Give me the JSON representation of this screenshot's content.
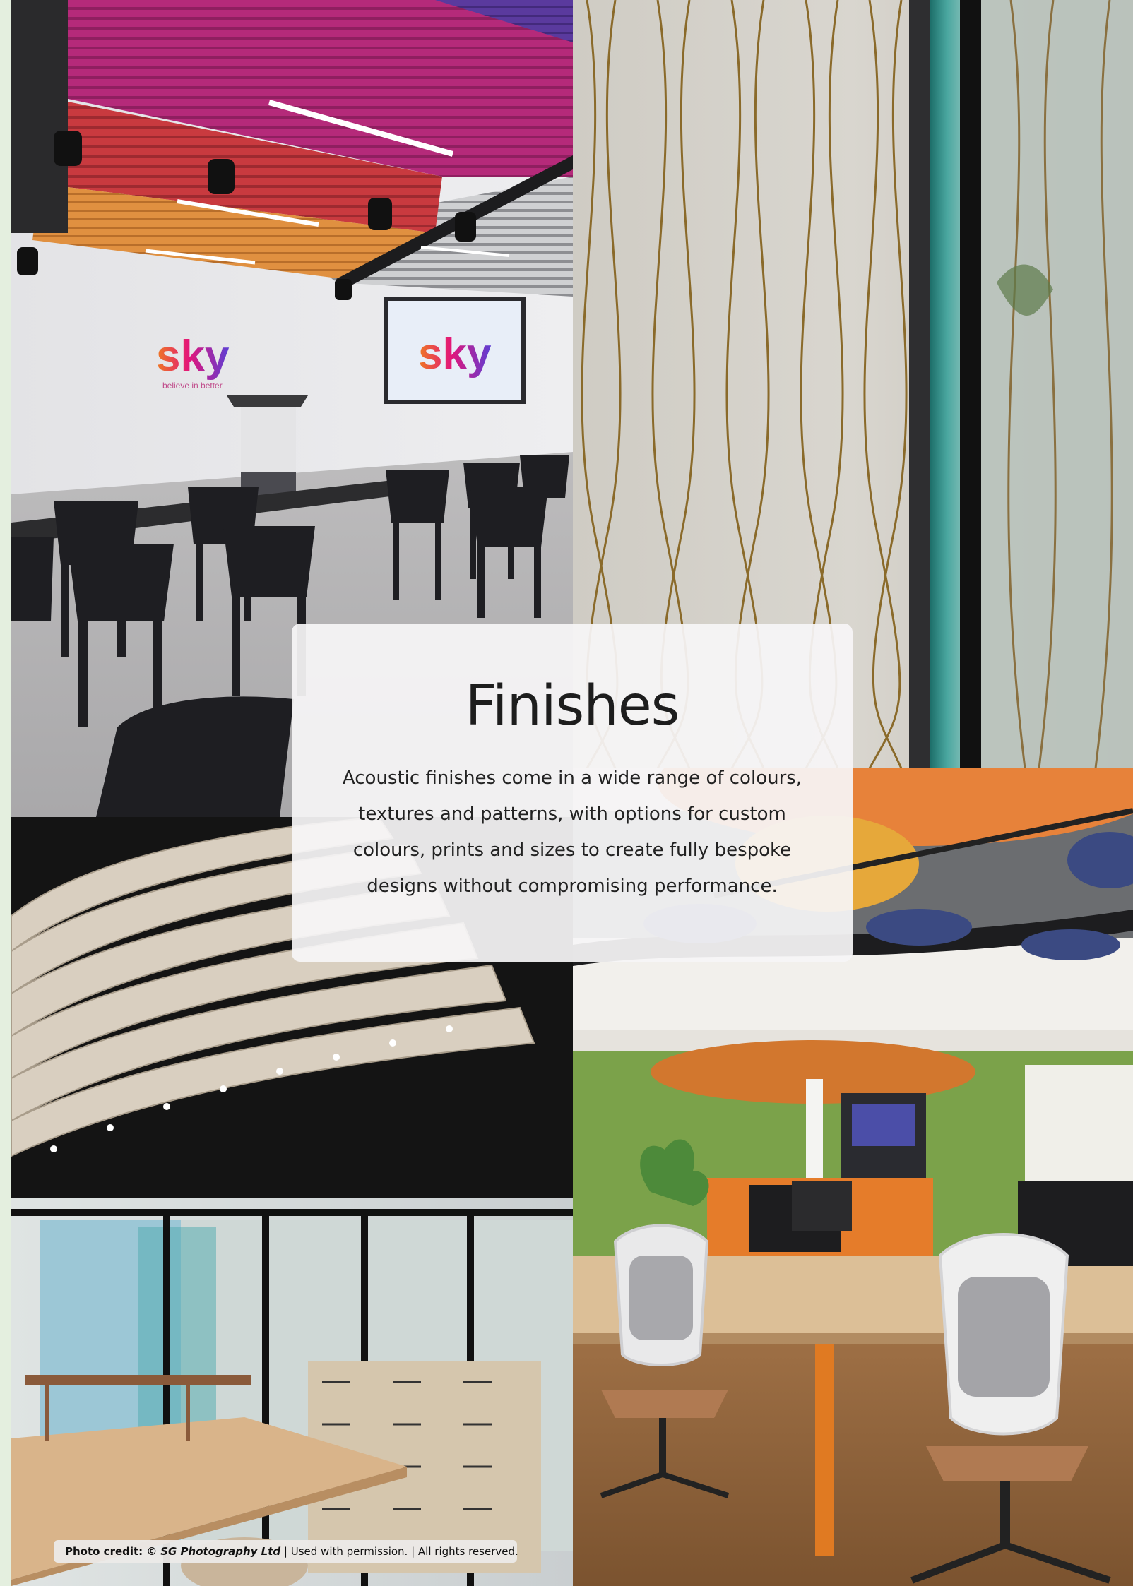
{
  "page": {
    "title": "Finishes",
    "description": "Acoustic finishes come in a wide range of colours, textures and patterns, with options for custom colours, prints and sizes to create fully bespoke designs without compromising performance."
  },
  "photos": {
    "top_left": {
      "sky_logo_wall": "sky",
      "sky_tagline": "believe in better",
      "sky_logo_screen": "sky"
    }
  },
  "credit": {
    "prefix": "Photo credit: ©",
    "photographer": "SG Photography Ltd",
    "suffix": "| Used with permission. | All rights reserved."
  }
}
